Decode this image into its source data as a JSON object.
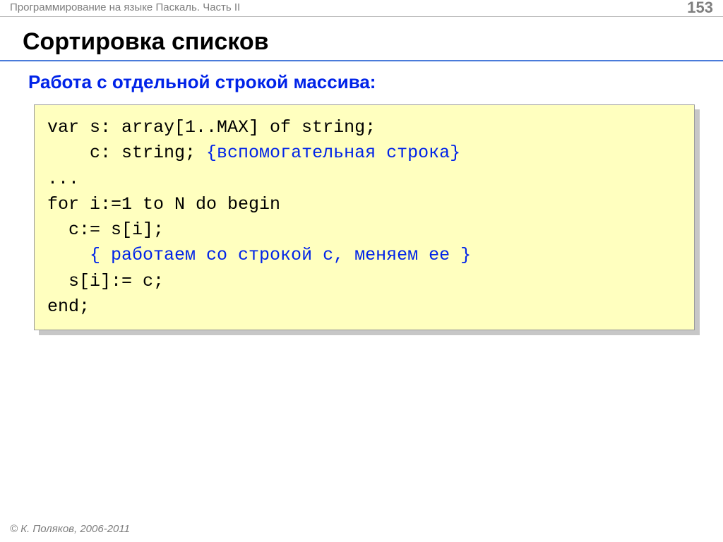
{
  "header": {
    "left": "Программирование на языке Паскаль. Часть II",
    "page": "153"
  },
  "title": "Сортировка списков",
  "subtitle": "Работа с отдельной строкой массива:",
  "code": {
    "l1": "var s: array[1..MAX] of string;",
    "l2a": "    c: string; ",
    "l2b": "{вспомогательная строка}",
    "l3": "...",
    "l4": "for i:=1 to N do begin",
    "l5": "  c:= s[i];",
    "l6a": "    ",
    "l6b": "{ работаем со строкой c, меняем ее }",
    "l7": "  s[i]:= c;",
    "l8": "end;"
  },
  "footer": "© К. Поляков, 2006-2011"
}
